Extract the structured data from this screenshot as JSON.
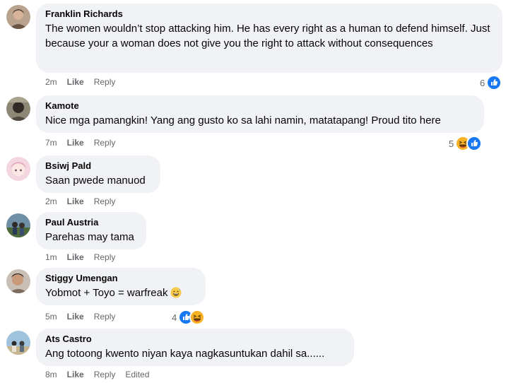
{
  "comments": [
    {
      "author": "Franklin Richards",
      "text": "The women wouldn’t stop attacking him. He has every right as a human to defend himself. Just because your a woman does not give you the right to attack without consequences",
      "time": "2m",
      "like": "Like",
      "reply": "Reply",
      "reaction_count": "6",
      "reactions": [
        "like-icon"
      ]
    },
    {
      "author": "Kamote",
      "text": "Nice mga pamangkin! Yang ang gusto ko sa lahi namin, matatapang! Proud tito here",
      "time": "7m",
      "like": "Like",
      "reply": "Reply",
      "reaction_count": "5",
      "reactions": [
        "haha-icon",
        "like-icon"
      ]
    },
    {
      "author": "Bsiwj Pald",
      "text": "Saan pwede manuod",
      "time": "2m",
      "like": "Like",
      "reply": "Reply"
    },
    {
      "author": "Paul Austria",
      "text": "Parehas may tama",
      "time": "1m",
      "like": "Like",
      "reply": "Reply"
    },
    {
      "author": "Stiggy Umengan",
      "text": "Yobmot + Toyo = warfreak",
      "text_emoji": "grinning-sweat-emoji",
      "time": "5m",
      "like": "Like",
      "reply": "Reply",
      "reaction_count": "4",
      "reactions": [
        "like-icon",
        "haha-icon"
      ]
    },
    {
      "author": "Ats Castro",
      "text": "Ang totoong kwento niyan kaya nagkasuntukan dahil sa......",
      "time": "8m",
      "like": "Like",
      "reply": "Reply",
      "edited": "Edited"
    }
  ],
  "colors": {
    "bubble": "#f0f2f5",
    "meta": "#65676b",
    "like_blue": "#1877f2",
    "haha_yellow": "#f7b125"
  }
}
